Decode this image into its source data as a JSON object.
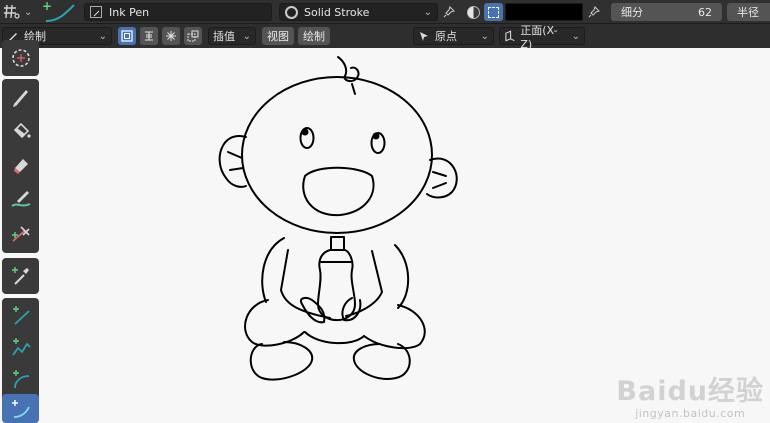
{
  "header": {
    "brush_name": "Ink Pen",
    "material_name": "Solid Stroke",
    "thickness_label": "细分",
    "thickness_value": "62",
    "radius_label": "半径"
  },
  "tool_settings": {
    "mode": "绘制",
    "interpolate": "插值",
    "view": "视图",
    "draw": "绘制",
    "origin": "原点",
    "plane": "正面(X-Z)"
  },
  "colors": {
    "accent": "#4772b3",
    "viewport_bg": "#f7f7f7",
    "stroke_color": "#000000",
    "add_plus": "#62d27c"
  },
  "toolbar_tools": [
    "select-circle-icon",
    "draw-icon",
    "fill-icon",
    "erase-icon",
    "tint-icon",
    "cutter-icon",
    "eyedropper-icon",
    "line-icon",
    "polyline-icon",
    "arc-icon",
    "curve-icon"
  ],
  "watermark": {
    "logo": "Baidu经验",
    "url": "jingyan.baidu.com"
  }
}
